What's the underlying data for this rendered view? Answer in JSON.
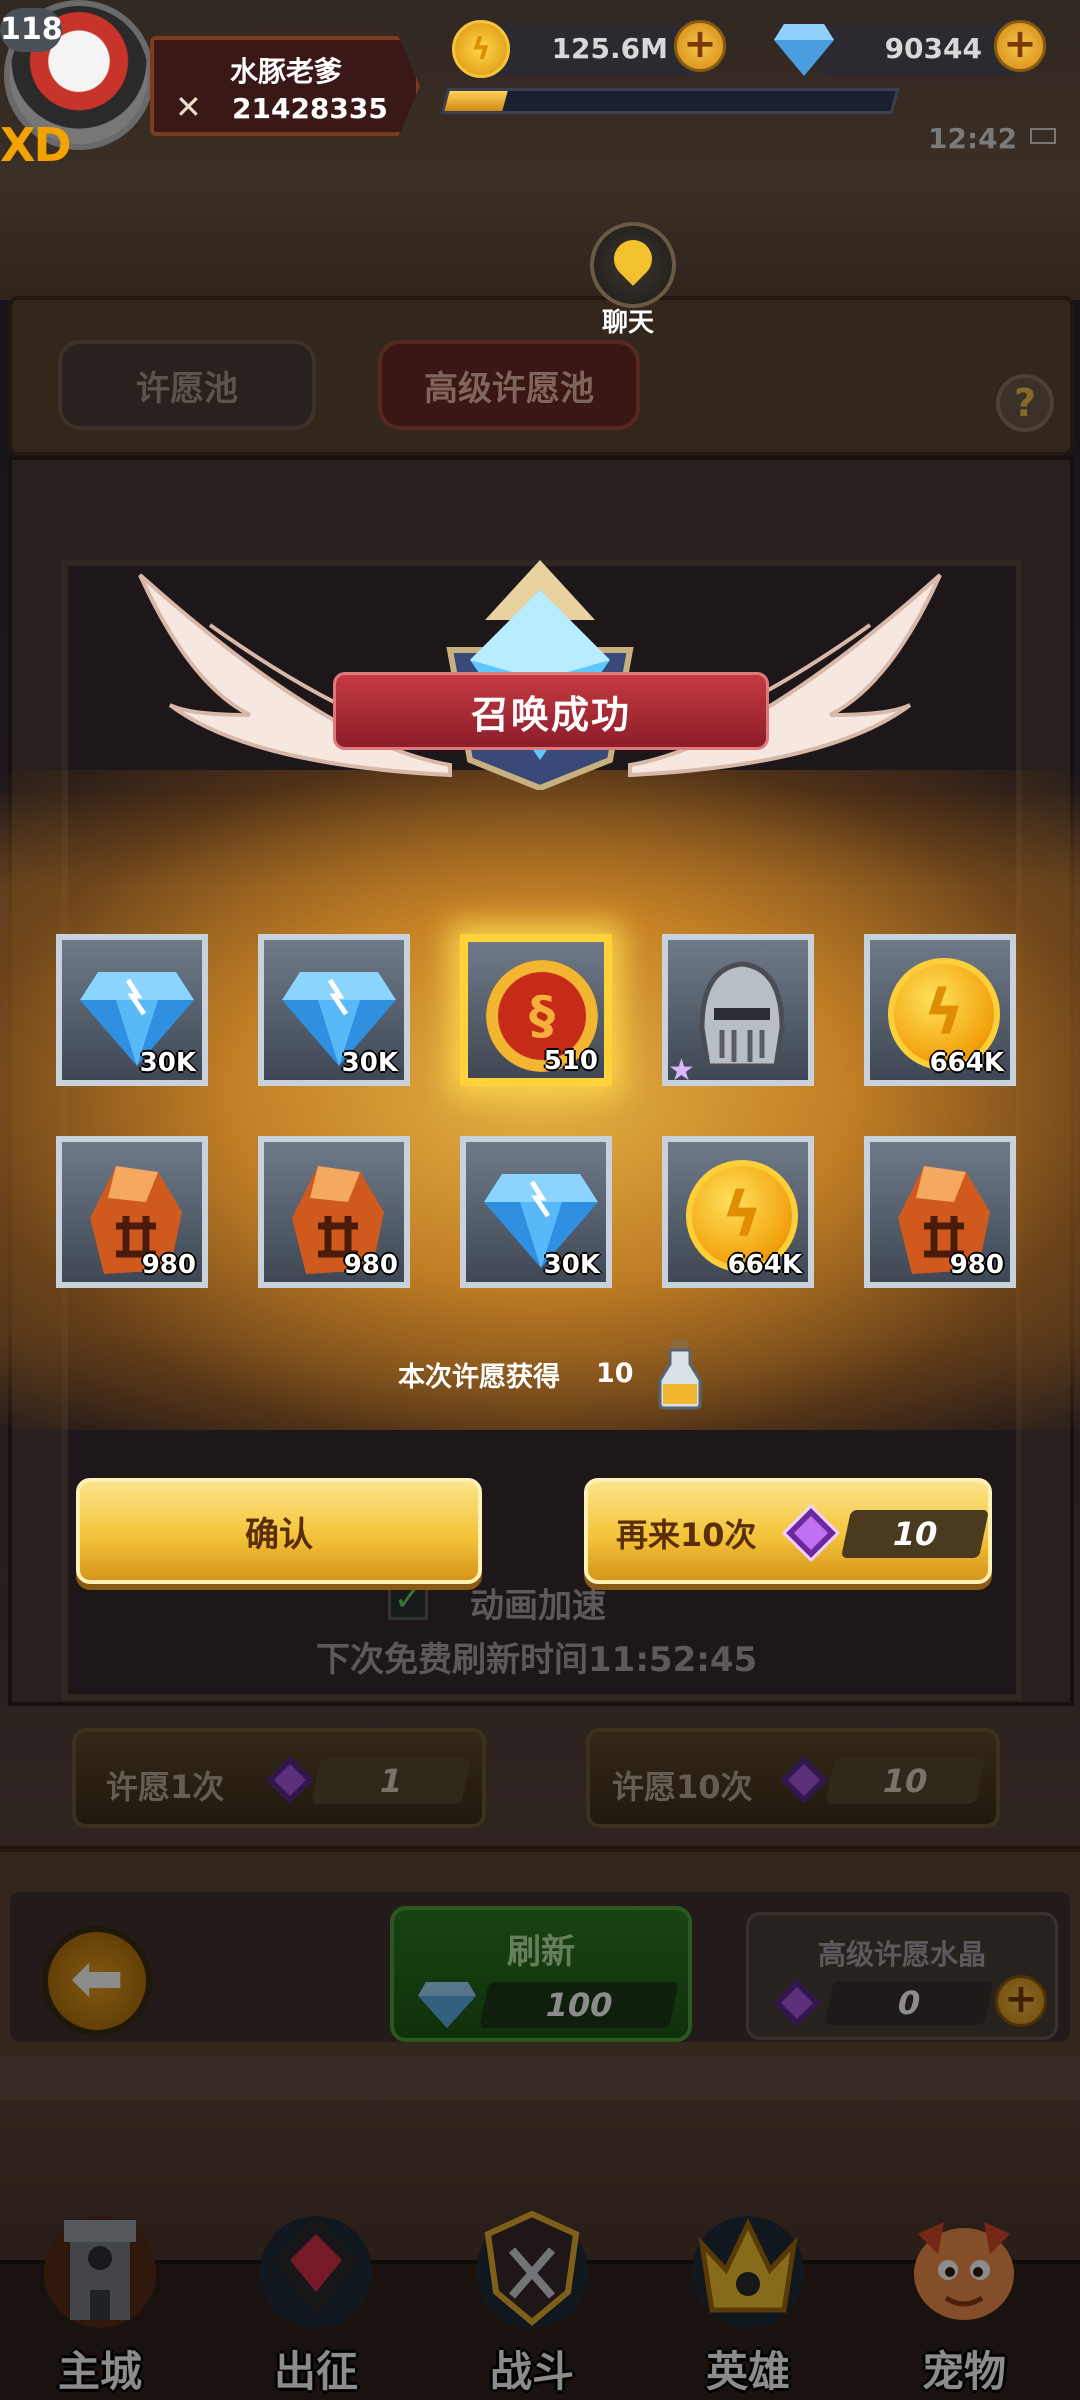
{
  "hud": {
    "level": "118",
    "player_name": "水豚老爹",
    "power": "21428335",
    "gold": "125.6M",
    "diamonds": "90344",
    "time": "12:42",
    "xp_fraction": 0.13,
    "logo_text": "XD"
  },
  "chat": {
    "label": "聊天"
  },
  "tabs": {
    "normal": "许愿池",
    "advanced": "高级许愿池"
  },
  "help_label": "?",
  "popup": {
    "title": "召唤成功",
    "rewards": [
      {
        "item": "diamond-icon",
        "qty": "30K"
      },
      {
        "item": "diamond-icon",
        "qty": "30K"
      },
      {
        "item": "medal-icon",
        "qty": "510",
        "highlighted": true
      },
      {
        "item": "helmet-icon",
        "qty": "",
        "rarity_star": "★"
      },
      {
        "item": "gold-coin-icon",
        "qty": "664K"
      },
      {
        "item": "rune-stone-icon",
        "qty": "980"
      },
      {
        "item": "rune-stone-icon",
        "qty": "980"
      },
      {
        "item": "diamond-icon",
        "qty": "30K"
      },
      {
        "item": "gold-coin-icon",
        "qty": "664K"
      },
      {
        "item": "rune-stone-icon",
        "qty": "980"
      }
    ],
    "wish_result_label": "本次许愿获得",
    "wish_result_value": "10",
    "confirm_label": "确认",
    "again_label": "再来10次",
    "again_cost": "10"
  },
  "controls": {
    "check_mark": "✓",
    "animation_speedup_label": "动画加速",
    "next_free_refresh": "下次免费刷新时间11:52:45",
    "wish_once_label": "许愿1次",
    "wish_once_cost": "1",
    "wish_ten_label": "许愿10次",
    "wish_ten_cost": "10"
  },
  "console": {
    "back_glyph": "⬅",
    "refresh_label": "刷新",
    "refresh_cost": "100",
    "crystal_label": "高级许愿水晶",
    "crystal_count": "0"
  },
  "nav": [
    {
      "label": "主城",
      "icon": "castle-tower-icon"
    },
    {
      "label": "出征",
      "icon": "expedition-icon"
    },
    {
      "label": "战斗",
      "icon": "battle-shield-icon"
    },
    {
      "label": "英雄",
      "icon": "hero-crown-icon"
    },
    {
      "label": "宠物",
      "icon": "pet-dragon-icon"
    }
  ],
  "colors": {
    "gold": "#f4c43a",
    "banner_red": "#b02a36",
    "highlight": "#ffd23a",
    "refresh_green": "#2f7a24"
  }
}
